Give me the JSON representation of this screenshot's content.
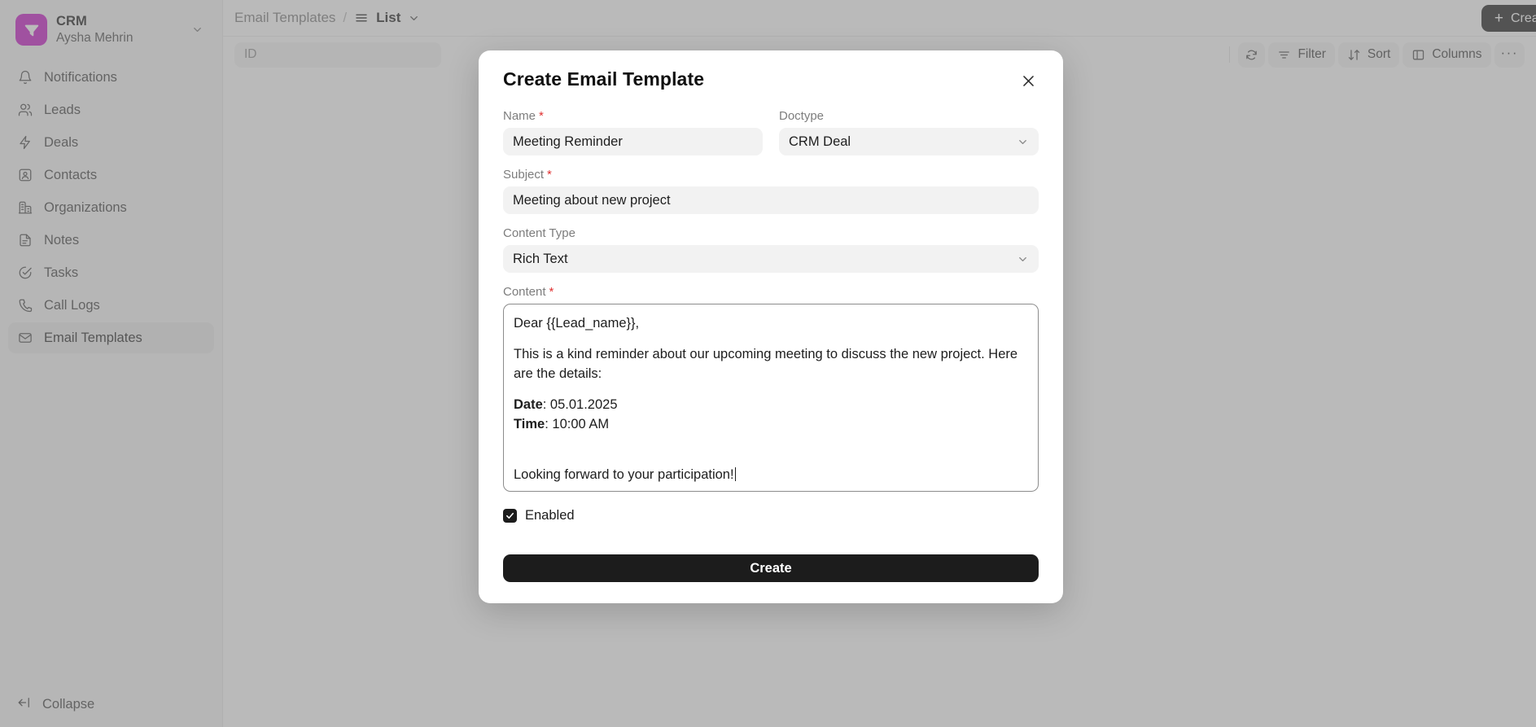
{
  "sidebar": {
    "workspace": {
      "title": "CRM",
      "user": "Aysha Mehrin",
      "logo_icon": "funnel-logo-icon",
      "chevron_icon": "chevron-down-icon",
      "brand_color": "#c518c5"
    },
    "items": [
      {
        "label": "Notifications",
        "icon": "bell-icon",
        "active": false
      },
      {
        "label": "Leads",
        "icon": "users-icon",
        "active": false
      },
      {
        "label": "Deals",
        "icon": "bolt-icon",
        "active": false
      },
      {
        "label": "Contacts",
        "icon": "contact-card-icon",
        "active": false
      },
      {
        "label": "Organizations",
        "icon": "building-icon",
        "active": false
      },
      {
        "label": "Notes",
        "icon": "note-icon",
        "active": false
      },
      {
        "label": "Tasks",
        "icon": "check-circle-icon",
        "active": false
      },
      {
        "label": "Call Logs",
        "icon": "phone-icon",
        "active": false
      },
      {
        "label": "Email Templates",
        "icon": "envelope-icon",
        "active": true
      }
    ],
    "collapse": {
      "label": "Collapse",
      "icon": "collapse-arrow-icon"
    }
  },
  "topbar": {
    "breadcrumb_root": "Email Templates",
    "breadcrumb_separator": "/",
    "view_label": "List",
    "view_icon": "list-icon",
    "view_chevron_icon": "chevron-down-icon",
    "create": {
      "label": "Create",
      "plus": "+"
    }
  },
  "toolbar": {
    "filter_placeholder": "ID",
    "refresh_icon": "refresh-icon",
    "buttons": [
      {
        "label": "Filter",
        "icon": "filter-icon"
      },
      {
        "label": "Sort",
        "icon": "sort-icon"
      },
      {
        "label": "Columns",
        "icon": "columns-icon"
      }
    ],
    "more_label": "···"
  },
  "modal": {
    "title": "Create Email Template",
    "close_icon": "close-icon",
    "fields": {
      "name": {
        "label": "Name",
        "required": true,
        "value": "Meeting Reminder"
      },
      "doctype": {
        "label": "Doctype",
        "required": false,
        "value": "CRM Deal",
        "chevron_icon": "chevron-down-icon"
      },
      "subject": {
        "label": "Subject",
        "required": true,
        "value": "Meeting about new project"
      },
      "content_type": {
        "label": "Content Type",
        "required": false,
        "value": "Rich Text",
        "chevron_icon": "chevron-down-icon"
      },
      "content": {
        "label": "Content",
        "required": true,
        "lines": {
          "greeting": "Dear {{Lead_name}},",
          "intro": "This is a kind reminder about our upcoming meeting to discuss the new project. Here are the details:",
          "date_label": "Date",
          "date_value": ": 05.01.2025",
          "time_label": "Time",
          "time_value": ": 10:00 AM",
          "closing": "Looking forward to your participation!"
        }
      }
    },
    "enabled": {
      "label": "Enabled",
      "checked": true,
      "check_icon": "checkmark-icon"
    },
    "submit_label": "Create"
  }
}
